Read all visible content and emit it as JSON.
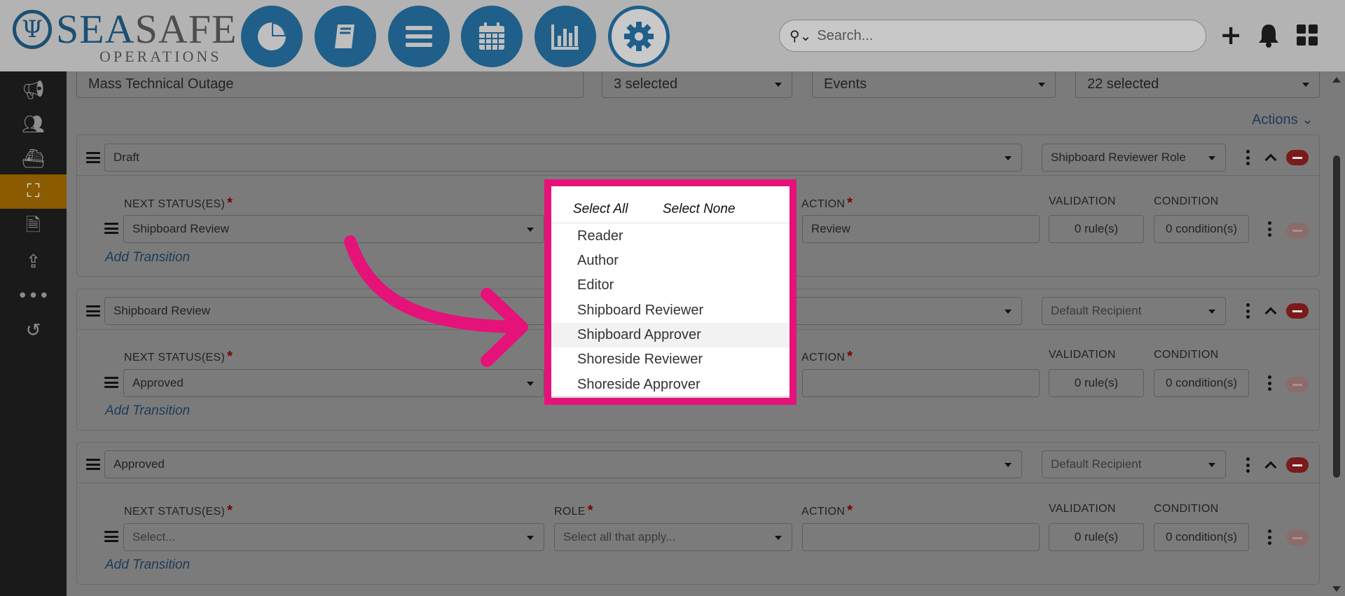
{
  "brand": {
    "name_part1": "SEA",
    "name_part2": "SAFE",
    "subtitle": "OPERATIONS"
  },
  "top_nav": [
    {
      "icon": "dashboard-pie-icon"
    },
    {
      "icon": "book-icon"
    },
    {
      "icon": "list-icon"
    },
    {
      "icon": "calendar-icon"
    },
    {
      "icon": "bar-chart-icon"
    },
    {
      "icon": "gear-icon",
      "active": true
    }
  ],
  "search": {
    "placeholder": "Search..."
  },
  "toolbar_icons": [
    "plus-icon",
    "bell-icon",
    "grid-icon"
  ],
  "sidebar": {
    "items": [
      {
        "icon": "megaphone-icon"
      },
      {
        "icon": "users-icon"
      },
      {
        "icon": "ship-icon"
      },
      {
        "icon": "cubes-icon",
        "active": true
      },
      {
        "icon": "document-icon"
      },
      {
        "icon": "upload-icon"
      },
      {
        "icon": "more-icon"
      },
      {
        "icon": "history-icon"
      }
    ]
  },
  "form_header": {
    "name_value": "Mass Technical Outage",
    "select1_value": "3 selected",
    "select2_value": "Events",
    "select3_value": "22 selected",
    "actions_label": "Actions ⌄"
  },
  "statuses": [
    {
      "status": "Draft",
      "recipient": "Shipboard Reviewer Role",
      "transition": {
        "next_status": "Shipboard Review",
        "role": "",
        "action": "Review",
        "validation": "0 rule(s)",
        "condition": "0 condition(s)"
      }
    },
    {
      "status": "Shipboard Review",
      "recipient": "Default Recipient",
      "transition": {
        "next_status": "Approved",
        "role": "",
        "action": "",
        "validation": "0 rule(s)",
        "condition": "0 condition(s)"
      }
    },
    {
      "status": "Approved",
      "recipient": "Default Recipient",
      "transition": {
        "next_status": "Select...",
        "role": "Select all that apply...",
        "action": "",
        "validation": "0 rule(s)",
        "condition": "0 condition(s)"
      }
    }
  ],
  "labels": {
    "next_status": "NEXT STATUS(ES)",
    "role": "ROLE",
    "action": "ACTION",
    "validation": "VALIDATION",
    "condition": "CONDITION",
    "required_mark": "*",
    "add_transition": "Add Transition"
  },
  "role_dropdown": {
    "select_all": "Select All",
    "select_none": "Select None",
    "options": [
      "Reader",
      "Author",
      "Editor",
      "Shipboard Reviewer",
      "Shipboard Approver",
      "Shoreside Reviewer",
      "Shoreside Approver"
    ],
    "highlighted": "Shipboard Approver"
  },
  "colors": {
    "highlight_frame": "#e5127a",
    "nav_blue": "#1f5f8a",
    "sidebar_active": "#8a5b00",
    "danger": "#7a1a1a"
  }
}
